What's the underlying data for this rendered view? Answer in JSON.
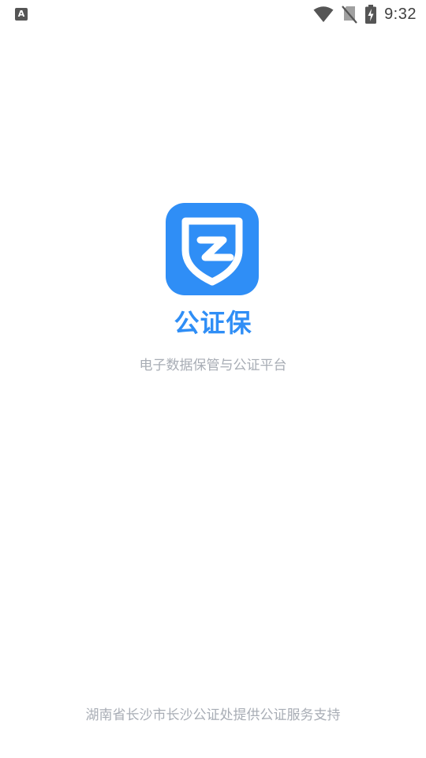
{
  "status_bar": {
    "left_icon_letter": "A",
    "time": "9:32",
    "icons": [
      "wifi-icon",
      "no-sim-icon",
      "battery-charging-icon"
    ]
  },
  "splash": {
    "logo_icon": "shield-z-logo-icon",
    "app_name": "公证保",
    "slogan": "电子数据保管与公证平台"
  },
  "footer": {
    "text": "湖南省长沙市长沙公证处提供公证服务支持"
  },
  "colors": {
    "brand_blue": "#2f8ef6",
    "muted_text": "#a8adb5",
    "background": "#ffffff"
  }
}
